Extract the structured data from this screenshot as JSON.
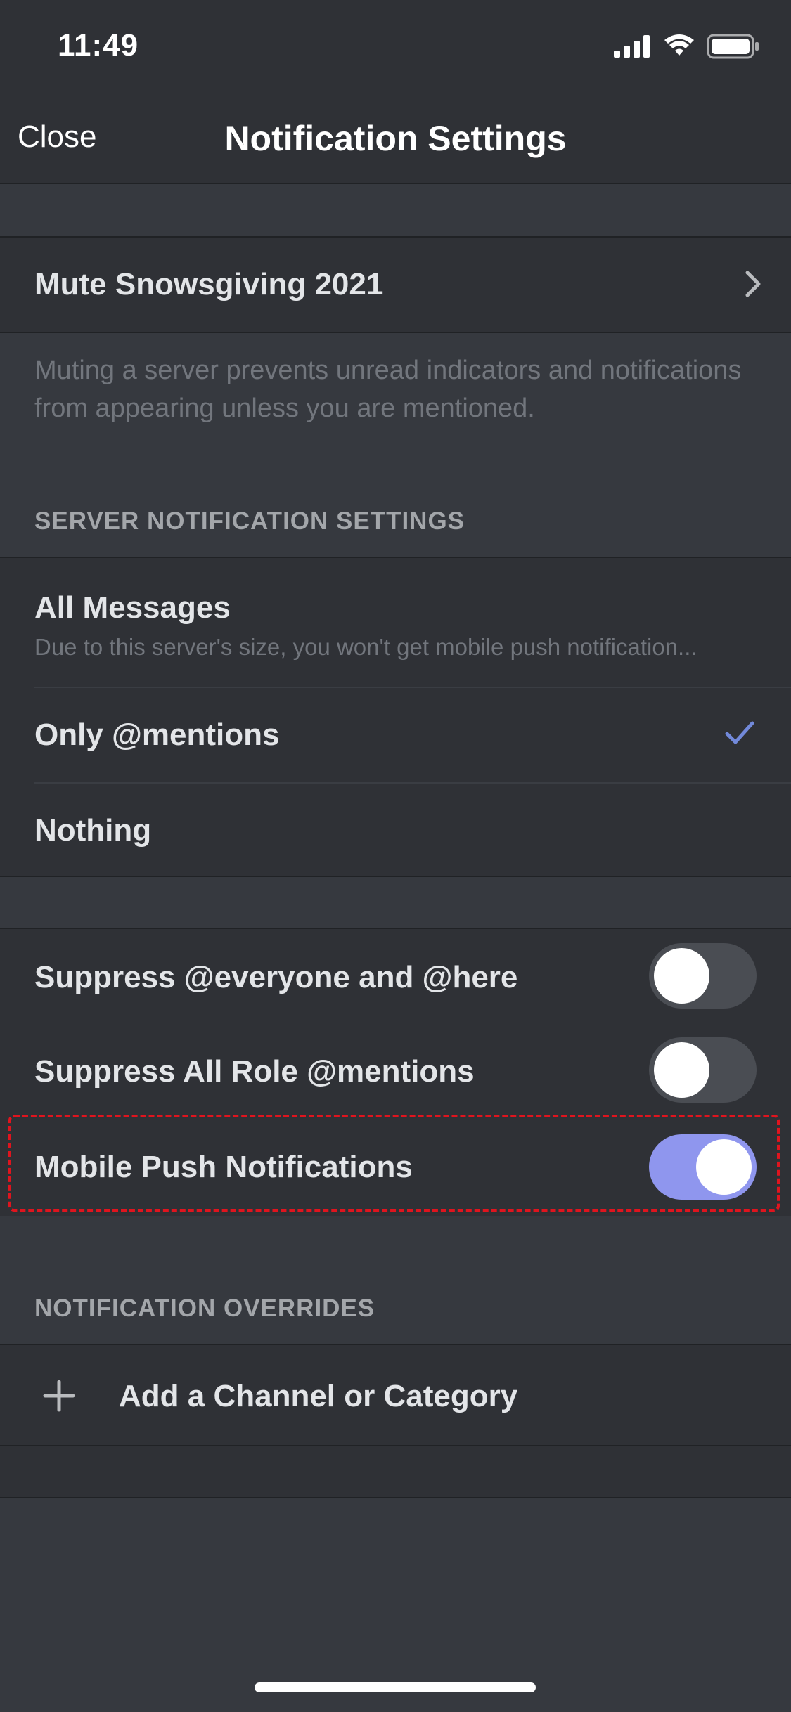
{
  "status_bar": {
    "time": "11:49",
    "icons": [
      "signal-icon",
      "wifi-icon",
      "battery-icon"
    ]
  },
  "nav": {
    "close_label": "Close",
    "title": "Notification Settings"
  },
  "mute": {
    "label": "Mute Snowsgiving 2021",
    "helper": "Muting a server prevents unread indicators and notifications from appearing unless you are mentioned."
  },
  "server_settings": {
    "header": "SERVER NOTIFICATION SETTINGS",
    "options": [
      {
        "label": "All Messages",
        "sublabel": "Due to this server's size, you won't get mobile push notification...",
        "selected": false
      },
      {
        "label": "Only @mentions",
        "selected": true
      },
      {
        "label": "Nothing",
        "selected": false
      }
    ]
  },
  "toggles": [
    {
      "label": "Suppress @everyone and @here",
      "on": false
    },
    {
      "label": "Suppress All Role @mentions",
      "on": false
    },
    {
      "label": "Mobile Push Notifications",
      "on": true
    }
  ],
  "overrides": {
    "header": "NOTIFICATION OVERRIDES",
    "add_label": "Add a Channel or Category"
  },
  "colors": {
    "background": "#36393f",
    "surface": "#2f3136",
    "accent": "#8f96ee",
    "check": "#7289da",
    "highlight": "#e0141e"
  }
}
